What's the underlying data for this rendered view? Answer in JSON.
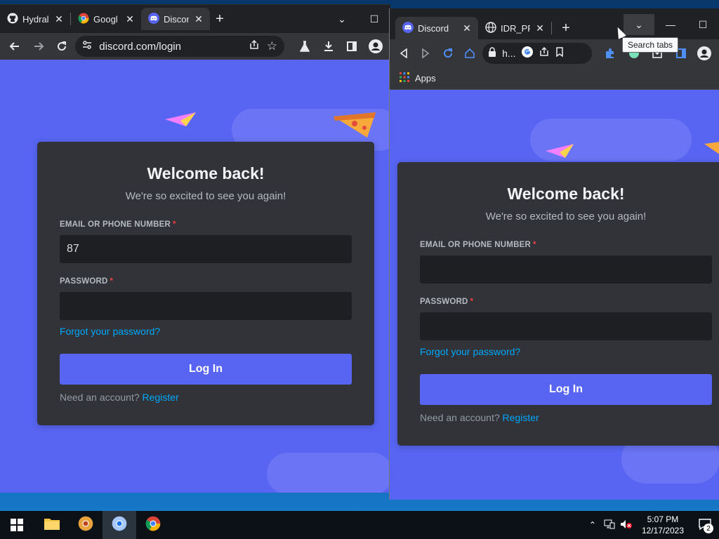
{
  "window_left": {
    "tabs": [
      {
        "label": "Hydral",
        "icon": "github-icon"
      },
      {
        "label": "Googl",
        "icon": "chrome-icon"
      },
      {
        "label": "Discor",
        "icon": "discord-icon",
        "active": true
      }
    ],
    "url": "discord.com/login"
  },
  "window_right": {
    "tabs": [
      {
        "label": "Discord",
        "icon": "discord-icon",
        "active": true
      },
      {
        "label": "IDR_PRC",
        "icon": "globe-icon"
      }
    ],
    "url_short": "h...",
    "bookmarks_apps_label": "Apps",
    "tooltip": "Search tabs"
  },
  "login_left": {
    "title": "Welcome back!",
    "subtitle": "We're so excited to see you again!",
    "email_label": "EMAIL OR PHONE NUMBER",
    "email_value": "87",
    "password_label": "PASSWORD",
    "password_value": "",
    "required_mark": "*",
    "forgot": "Forgot your password?",
    "login_button": "Log In",
    "need_account": "Need an account?",
    "register": "Register"
  },
  "login_right": {
    "title": "Welcome back!",
    "subtitle": "We're so excited to see you again!",
    "email_label": "EMAIL OR PHONE NUMBER",
    "email_value": "",
    "password_label": "PASSWORD",
    "password_value": "",
    "required_mark": "*",
    "forgot": "Forgot your password?",
    "login_button": "Log In",
    "need_account": "Need an account?",
    "register": "Register"
  },
  "taskbar": {
    "clock_time": "5:07 PM",
    "clock_date": "12/17/2023",
    "notification_count": "2"
  },
  "colors": {
    "discord_blurple": "#5865f2",
    "card_bg": "#313338",
    "input_bg": "#1e1f22",
    "link": "#00a8fc",
    "required": "#f23f43"
  }
}
